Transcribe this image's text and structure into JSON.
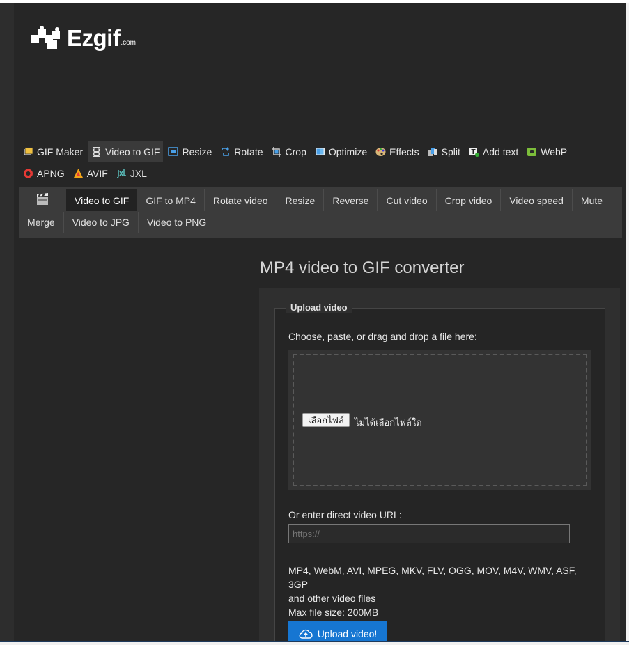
{
  "logo": {
    "name": "Ezgif",
    "domain": ".com"
  },
  "main_nav": {
    "row1": [
      {
        "label": "GIF Maker",
        "icon": "gif-maker-icon"
      },
      {
        "label": "Video to GIF",
        "icon": "film-icon",
        "active": true
      },
      {
        "label": "Resize",
        "icon": "resize-icon"
      },
      {
        "label": "Rotate",
        "icon": "rotate-icon"
      },
      {
        "label": "Crop",
        "icon": "crop-icon"
      },
      {
        "label": "Optimize",
        "icon": "optimize-icon"
      },
      {
        "label": "Effects",
        "icon": "palette-icon"
      },
      {
        "label": "Split",
        "icon": "split-icon"
      },
      {
        "label": "Add text",
        "icon": "add-text-icon"
      },
      {
        "label": "WebP",
        "icon": "webp-icon"
      }
    ],
    "row2": [
      {
        "label": "APNG",
        "icon": "apng-icon"
      },
      {
        "label": "AVIF",
        "icon": "avif-icon"
      },
      {
        "label": "JXL",
        "icon": "jxl-icon"
      }
    ]
  },
  "sub_nav": {
    "row1": [
      "Video to GIF",
      "GIF to MP4",
      "Rotate video",
      "Resize",
      "Reverse",
      "Cut video",
      "Crop video",
      "Video speed",
      "Mute"
    ],
    "row2": [
      "Merge",
      "Video to JPG",
      "Video to PNG"
    ]
  },
  "page_title": "MP4 video to GIF converter",
  "upload": {
    "legend": "Upload video",
    "choose_label": "Choose, paste, or drag and drop a file here:",
    "file_button": "เลือกไฟล์",
    "no_file_text": "ไม่ได้เลือกไฟล์ใด",
    "url_label": "Or enter direct video URL:",
    "url_placeholder": "https://",
    "formats_line1": "MP4, WebM, AVI, MPEG, MKV, FLV, OGG, MOV, M4V, WMV, ASF, 3GP",
    "formats_line2": "and other video files",
    "max_size": "Max file size: 200MB",
    "upload_button": "Upload video!"
  },
  "colors": {
    "background": "#262626",
    "subnav": "#3b3b3b",
    "accent": "#1676d2"
  }
}
